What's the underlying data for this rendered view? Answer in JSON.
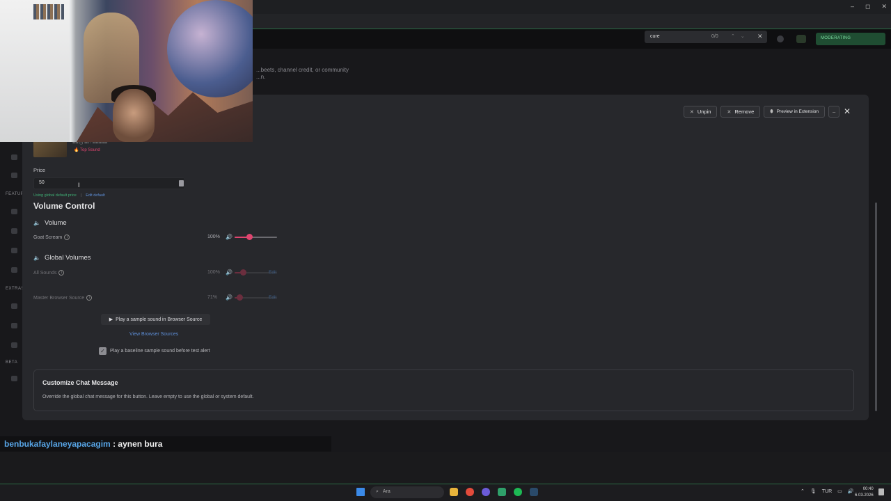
{
  "browser": {
    "window_controls": [
      "–",
      "◻",
      "✕"
    ],
    "find": {
      "query": "cure",
      "count": "0/0",
      "close": "✕"
    },
    "moderating_label": "MODERATING"
  },
  "background": {
    "description": "...beets, channel credit, or community\n...n."
  },
  "rail": {
    "labels": {
      "features": "FEATUR",
      "extras": "EXTRAS",
      "beta": "BETA"
    }
  },
  "modal": {
    "actions": {
      "unpin": "Unpin",
      "remove": "Remove",
      "preview": "Preview in Extension",
      "minimize": "–",
      "close": "✕"
    },
    "sound": {
      "tag": "Top Sound"
    },
    "price": {
      "label": "Price",
      "value": "50",
      "hint": "Using global default price",
      "separator": "|",
      "edit_default": "Edit default"
    },
    "volume_control": {
      "title": "Volume Control",
      "volume_heading": "Volume",
      "goat_scream": {
        "label": "Goat Scream",
        "pct": "100%",
        "level": 0.35
      },
      "global_heading": "Global Volumes",
      "all_sounds": {
        "label": "All Sounds",
        "pct": "100%",
        "level": 0.2,
        "edit": "Edit"
      },
      "master_browser": {
        "label": "Master Browser Source",
        "pct": "71%",
        "level": 0.12,
        "edit": "Edit"
      }
    },
    "sample_button": "Play a sample sound in Browser Source",
    "view_sources": "View Browser Sources",
    "baseline_label": "Play a baseline sample sound before test alert",
    "baseline_checked": true,
    "chat_card": {
      "title": "Customize Chat Message",
      "description": "Override the global chat message for this button. Leave empty to use the global or system default."
    }
  },
  "chat_overlay": {
    "user": "benbukafaylaneyapacagim",
    "separator": " : ",
    "message": "aynen bura"
  },
  "taskbar": {
    "search_placeholder": "Ara",
    "tray_lang": "TUR",
    "time": "00:40",
    "date": "6.03.2026"
  },
  "colors": {
    "accent": "#e0456f",
    "link": "#5e8fd8",
    "chat_user": "#58a6e8",
    "success": "#3fae74"
  }
}
